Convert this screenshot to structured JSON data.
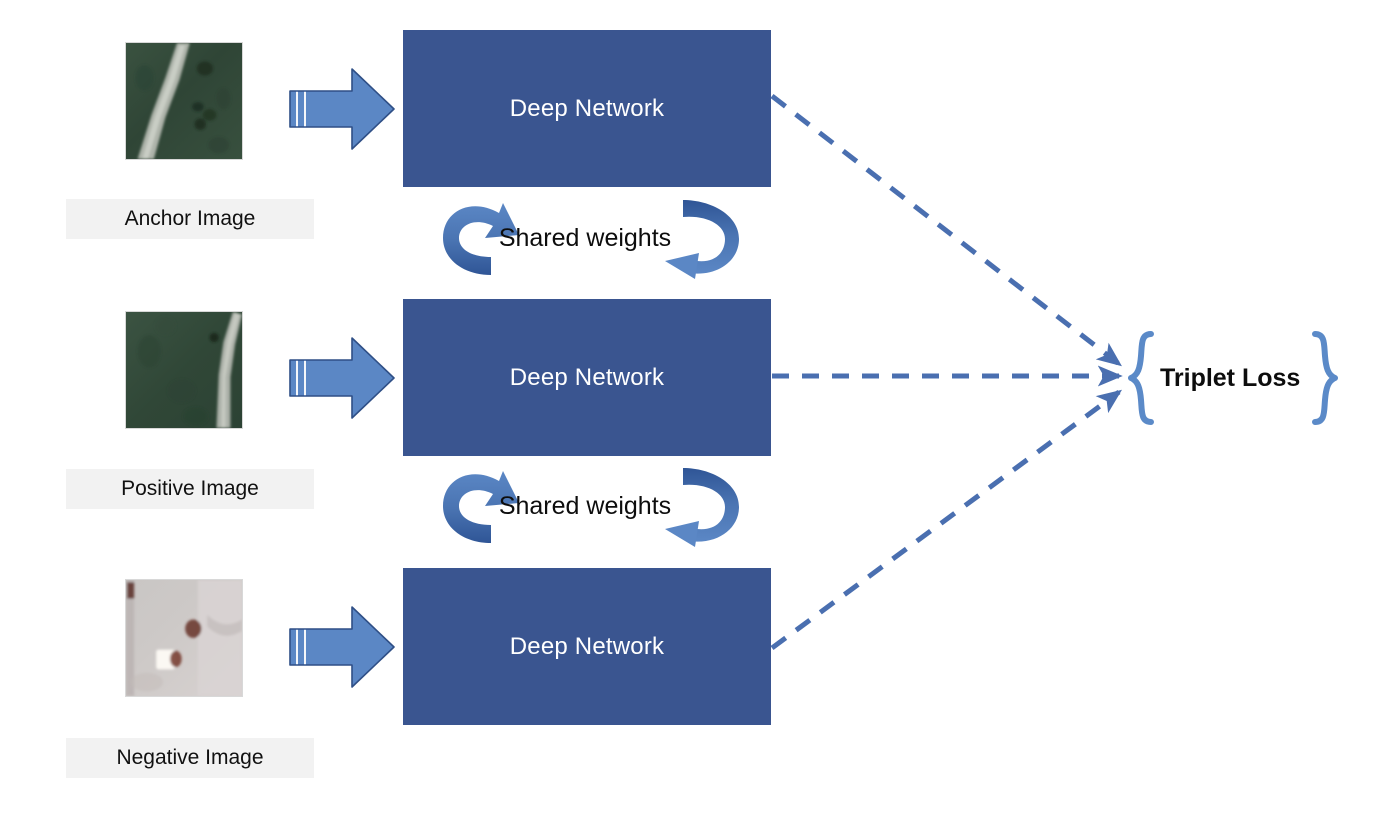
{
  "diagram": {
    "title": "Triplet network architecture with shared weights",
    "background_color": "#ffffff",
    "colors": {
      "network_box": "#3a5590",
      "network_box_text": "#ffffff",
      "block_arrow_fill": "#5b87c5",
      "block_arrow_stroke": "#2f4f86",
      "curved_arrow_light": "#5b87c5",
      "curved_arrow_dark": "#2f5596",
      "dashed_arrow": "#4a6fb0",
      "brace": "#5b8ac8",
      "caption_background": "#f2f2f2",
      "caption_text": "#111111",
      "label_text": "#0d0d0d"
    },
    "branches": [
      {
        "caption": "Anchor Image",
        "network_label": "Deep Network",
        "thumbnail_name": "anchor-satellite-thumbnail",
        "thumbnail_description": "dark green forest satellite tile with pale road running diagonally from top-centre to bottom-left"
      },
      {
        "caption": "Positive Image",
        "network_label": "Deep Network",
        "thumbnail_name": "positive-satellite-thumbnail",
        "thumbnail_description": "dark green forest satellite tile with pale road running vertically near the right edge"
      },
      {
        "caption": "Negative Image",
        "network_label": "Deep Network",
        "thumbnail_name": "negative-satellite-thumbnail",
        "thumbnail_description": "light grey and pink paved satellite tile with small brown and white objects"
      }
    ],
    "shared_weights": [
      {
        "label": "Shared weights"
      },
      {
        "label": "Shared weights"
      }
    ],
    "loss": {
      "label": "Triplet Loss",
      "left_brace": "{",
      "right_brace": "}"
    },
    "connections": [
      {
        "name": "anchor-to-loss",
        "style": "dashed",
        "direction": "down-right"
      },
      {
        "name": "positive-to-loss",
        "style": "dashed",
        "direction": "right"
      },
      {
        "name": "negative-to-loss",
        "style": "dashed",
        "direction": "up-right"
      }
    ]
  }
}
